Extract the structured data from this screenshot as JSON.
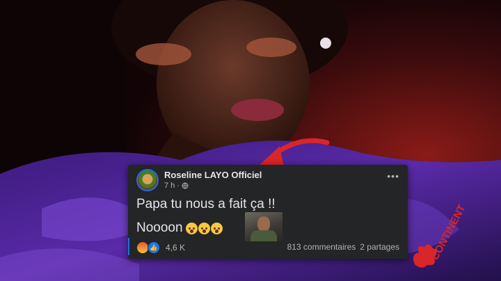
{
  "post": {
    "author": "Roseline LAYO Officiel",
    "time": "7 h ·",
    "privacy_icon": "globe-icon",
    "more_label": "•••",
    "line1": "Papa tu nous a fait ça !!",
    "line2": "Noooon",
    "emojis": [
      "crying-face",
      "crying-face",
      "crying-face"
    ],
    "reaction_count": "4,6 K",
    "comments": "813 commentaires",
    "shares": "2 partages"
  },
  "watermark": {
    "text": "CONTINENT"
  },
  "colors": {
    "card": "#242526",
    "text": "#e4e6eb",
    "muted": "#b0b3b8",
    "accent": "#1877f2",
    "arrow": "#d8262a"
  }
}
